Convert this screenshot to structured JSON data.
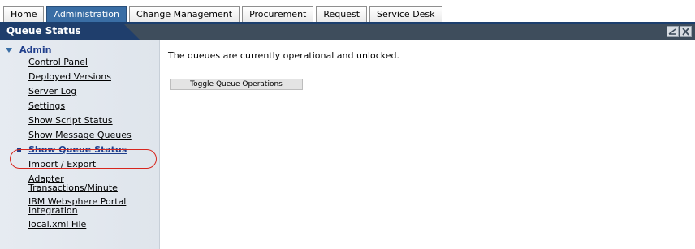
{
  "tabs": [
    {
      "label": "Home",
      "active": false
    },
    {
      "label": "Administration",
      "active": true
    },
    {
      "label": "Change Management",
      "active": false
    },
    {
      "label": "Procurement",
      "active": false
    },
    {
      "label": "Request",
      "active": false
    },
    {
      "label": "Service Desk",
      "active": false
    }
  ],
  "titlebar": {
    "title": "Queue Status",
    "buttons": [
      "minimize-icon",
      "close-icon"
    ]
  },
  "sidebar": {
    "section_label": "Admin",
    "items": [
      {
        "label": "Control Panel"
      },
      {
        "label": "Deployed Versions"
      },
      {
        "label": "Server Log"
      },
      {
        "label": "Settings"
      },
      {
        "label": "Show Script Status"
      },
      {
        "label": "Show Message Queues"
      },
      {
        "label": "Show Queue Status",
        "current": true
      },
      {
        "label": "Import / Export"
      },
      {
        "label": "Adapter Transactions/Minute"
      },
      {
        "label": "IBM Websphere Portal Integration"
      },
      {
        "label": "local.xml File"
      }
    ]
  },
  "main": {
    "status_message": "The queues are currently operational and unlocked.",
    "toggle_button_label": "Toggle Queue Operations"
  },
  "colors": {
    "active_tab": "#3a6ea5",
    "title_tab": "#1f3e6c",
    "titlebar_bg": "#3e4d5c",
    "link": "#1f3e8c",
    "highlight": "#d7261e"
  }
}
